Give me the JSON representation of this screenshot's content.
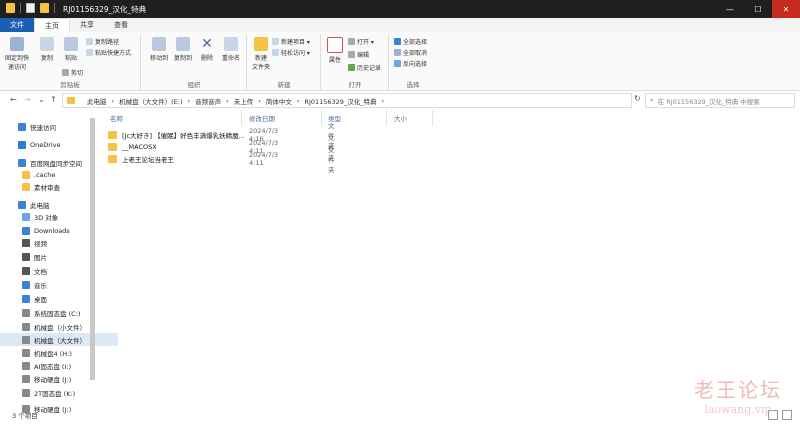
{
  "window": {
    "title": "RJ01156329_汉化_特典",
    "minimize": "—",
    "maximize": "☐",
    "close": "✕"
  },
  "tabs": [
    "文件",
    "主页",
    "共享",
    "查看"
  ],
  "ribbon": {
    "clipboard": {
      "label": "剪贴板",
      "pin": "固定到快\n速访问",
      "copy": "复制",
      "paste": "粘贴",
      "cut": "剪切",
      "copy_path": "复制路径",
      "paste_shortcut": "粘贴快捷方式"
    },
    "organize": {
      "label": "组织",
      "move_to": "移动到",
      "copy_to": "复制到",
      "delete": "删除",
      "rename": "重命名"
    },
    "new": {
      "label": "新建",
      "new_folder": "新建\n文件夹",
      "new_item": "新建项目 ▾",
      "easy_access": "轻松访问 ▾"
    },
    "open": {
      "label": "打开",
      "properties": "属性",
      "open": "打开 ▾",
      "edit": "编辑",
      "history": "历史记录"
    },
    "select": {
      "label": "选择",
      "select_all": "全部选择",
      "select_none": "全部取消",
      "invert": "反向选择"
    }
  },
  "address": {
    "back": "←",
    "forward": "→",
    "recent": "⌄",
    "up": "↑",
    "crumbs": [
      "此电脑",
      "›",
      "机械盘（大文件）(E:)",
      "›",
      "音频音声",
      "›",
      "未上传",
      "›",
      "简体中文",
      "›",
      "RJ01156329_汉化_特典",
      "›"
    ],
    "search_placeholder": "在 RJ01156329_汉化_特典 中搜索"
  },
  "nav": [
    {
      "label": "快速访问",
      "color": "#3b82d6"
    },
    {
      "label": "OneDrive",
      "color": "#2b7cd3"
    },
    {
      "label": "百度网盘同步空间",
      "color": "#3b82d6"
    },
    {
      "label": ".cache",
      "color": "#f5c242"
    },
    {
      "label": "素材审查",
      "color": "#f5c242"
    },
    {
      "label": "此电脑",
      "color": "#3b82d6"
    },
    {
      "label": "3D 对象",
      "color": "#6aa6e8"
    },
    {
      "label": "Downloads",
      "color": "#3b82d6"
    },
    {
      "label": "视频",
      "color": "#555"
    },
    {
      "label": "图片",
      "color": "#555"
    },
    {
      "label": "文档",
      "color": "#555"
    },
    {
      "label": "音乐",
      "color": "#3b82d6"
    },
    {
      "label": "桌面",
      "color": "#3b82d6"
    },
    {
      "label": "系统固态盘 (C:)",
      "color": "#888"
    },
    {
      "label": "机械盘（小文件）",
      "color": "#888"
    },
    {
      "label": "机械盘（大文件）",
      "color": "#888"
    },
    {
      "label": "机械盘4 (H:)",
      "color": "#888"
    },
    {
      "label": "AI固态盘 (I:)",
      "color": "#888"
    },
    {
      "label": "移动硬盘 (J:)",
      "color": "#888"
    },
    {
      "label": "2T固态盘 (K:)",
      "color": "#888"
    },
    {
      "label": "移动硬盘 (J:)",
      "color": "#888"
    }
  ],
  "columns": {
    "name": "名称",
    "date": "修改日期",
    "type": "类型",
    "size": "大小"
  },
  "files": [
    {
      "name": "[Jc大好き] 【催眠】好色丰满爆乳妖精魔...",
      "date": "2024/7/3 4:16",
      "type": "文件夹"
    },
    {
      "name": "__MACOSX",
      "date": "2024/7/3 4:11",
      "type": "文件夹"
    },
    {
      "name": "上老王论坛当老王",
      "date": "2024/7/3 4:11",
      "type": "文件夹"
    }
  ],
  "status": "3 个项目",
  "watermark": {
    "line1": "老王论坛",
    "line2": "laowang.vip"
  }
}
